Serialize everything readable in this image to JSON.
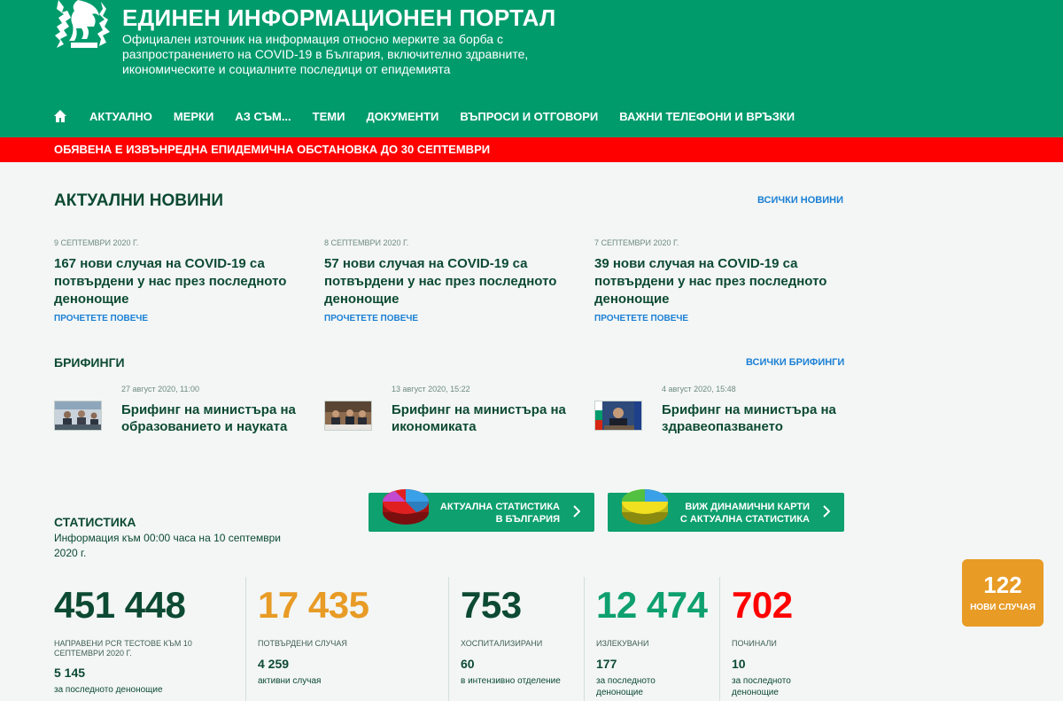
{
  "header": {
    "title": "ЕДИНЕН ИНФОРМАЦИОНЕН ПОРТАЛ",
    "subtitle": "Официален източник на информация относно мерките за борба с разпространението на COVID-19 в България, включително здравните, икономическите и социалните последици от епидемията",
    "logo_icon": "lion-coat-of-arms-icon"
  },
  "nav": {
    "home_icon": "home-icon",
    "items": [
      "АКТУАЛНО",
      "МЕРКИ",
      "АЗ СЪМ...",
      "ТЕМИ",
      "ДОКУМЕНТИ",
      "ВЪПРОСИ И ОТГОВОРИ",
      "ВАЖНИ ТЕЛЕФОНИ И ВРЪЗКИ"
    ]
  },
  "alert": {
    "text": "ОБЯВЕНА Е ИЗВЪНРЕДНА ЕПИДЕМИЧНА ОБСТАНОВКА ДО 30 СЕПТЕМВРИ"
  },
  "news": {
    "title": "АКТУАЛНИ НОВИНИ",
    "all_link": "ВСИЧКИ НОВИНИ",
    "items": [
      {
        "date": "9 септември 2020 г.",
        "title": "167 нови случая на COVID-19 са потвърдени у нас през последното денонощие",
        "more": "ПРОЧЕТЕТЕ ПОВЕЧЕ"
      },
      {
        "date": "8 септември 2020 г.",
        "title": "57 нови случая на COVID-19 са потвърдени у нас през последното денонощие",
        "more": "ПРОЧЕТЕТЕ ПОВЕЧЕ"
      },
      {
        "date": "7 септември 2020 г.",
        "title": "39 нови случая на COVID-19 са потвърдени у нас през последното денонощие",
        "more": "ПРОЧЕТЕТЕ ПОВЕЧЕ"
      }
    ]
  },
  "briefings": {
    "title": "БРИФИНГИ",
    "all_link": "ВСИЧКИ БРИФИНГИ",
    "items": [
      {
        "date": "27 август 2020, 11:00",
        "title": "Брифинг на министъра на образованието и науката"
      },
      {
        "date": "13 август 2020, 15:22",
        "title": "Брифинг на министъра на икономиката"
      },
      {
        "date": "4 август 2020, 15:48",
        "title": "Брифинг на министъра на здравеопазването"
      }
    ]
  },
  "stat_buttons": [
    {
      "line1": "АКТУАЛНА СТАТИСТИКА",
      "line2": "В БЪЛГАРИЯ"
    },
    {
      "line1": "ВИЖ ДИНАМИЧНИ КАРТИ",
      "line2": "С АКТУАЛНА СТАТИСТИКА"
    }
  ],
  "statistics": {
    "title": "СТАТИСТИКА",
    "info": "Информация към 00:00 часа на 10 септември 2020 г.",
    "columns": [
      {
        "value": "451 448",
        "label": "НАПРАВЕНИ PCR ТЕСТОВЕ КЪМ 10 СЕПТЕМВРИ 2020 Г.",
        "sub_value": "5 145",
        "sub_label": "за последното денонощие",
        "color": "#0d4a33"
      },
      {
        "value": "17 435",
        "label": "ПОТВЪРДЕНИ СЛУЧАЯ",
        "sub_value": "4 259",
        "sub_label": "активни случая",
        "color": "#e89b25"
      },
      {
        "value": "753",
        "label": "ХОСПИТАЛИЗИРАНИ",
        "sub_value": "60",
        "sub_label": "в интензивно отделение",
        "color": "#0d4a33"
      },
      {
        "value": "12 474",
        "label": "ИЗЛЕКУВАНИ",
        "sub_value": "177",
        "sub_label": "за последното денонощие",
        "color": "#0ea06f"
      },
      {
        "value": "702",
        "label": "ПОЧИНАЛИ",
        "sub_value": "10",
        "sub_label": "за последното денонощие",
        "color": "#ff0000"
      }
    ]
  },
  "new_cases": {
    "value": "122",
    "label": "НОВИ СЛУЧАЯ"
  }
}
